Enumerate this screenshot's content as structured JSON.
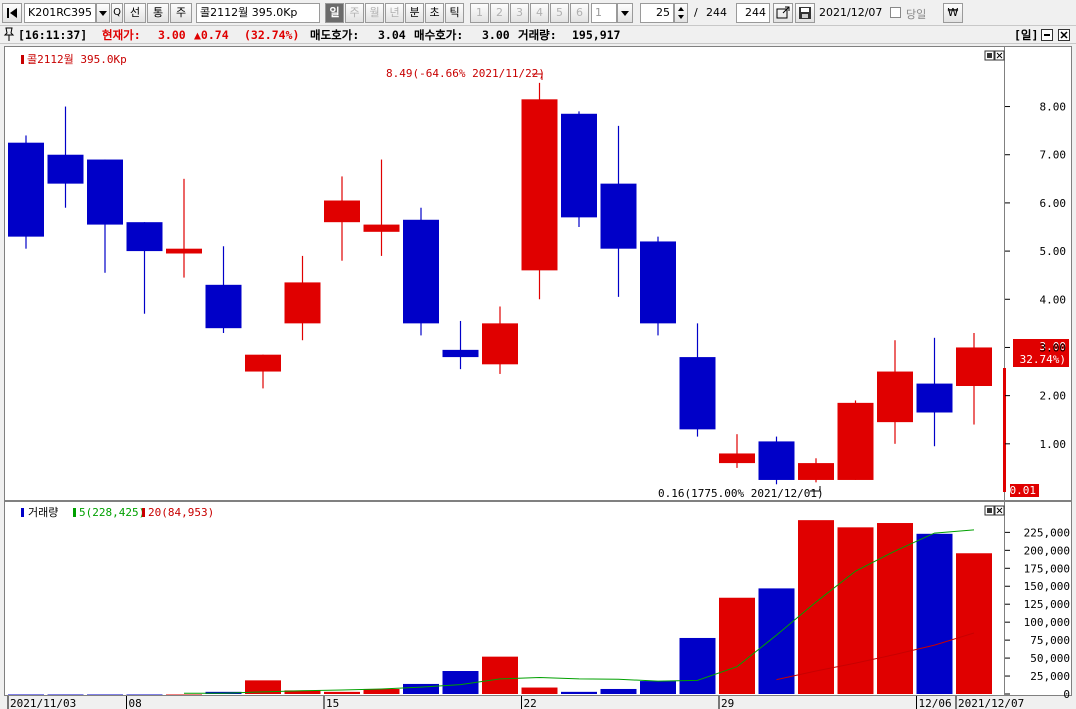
{
  "toolbar": {
    "prev_icon": "first-page-icon",
    "code": "K201RC395",
    "btn_search": "Q",
    "btn_prev_code": "선",
    "btn_compare": "통",
    "btn_main": "주",
    "name": "콜2112월 395.0Kp",
    "periods": [
      "일",
      "주",
      "월",
      "년",
      "분",
      "초",
      "틱"
    ],
    "period_active": "일",
    "numbers": [
      "1",
      "2",
      "3",
      "4",
      "5",
      "6"
    ],
    "number_select": "1",
    "count": "25",
    "slash": "/",
    "total": "244",
    "total_box": "244",
    "date": "2021/12/07",
    "same_day_label": "당일",
    "currency_icon": "₩"
  },
  "status": {
    "pin_icon": "pin-icon",
    "time": "[16:11:37]",
    "current_label": "현재가:",
    "current_value": "3.00",
    "change": "▲0.74",
    "change_pct": "(32.74%)",
    "ask_label": "매도호가:",
    "ask_value": "3.04",
    "bid_label": "매수호가:",
    "bid_value": "3.00",
    "volume_label": "거래량:",
    "volume_value": "195,917",
    "period_label": "[일]"
  },
  "price_panel": {
    "legend": "콜2112월 395.0Kp",
    "high_note": "8.49(-64.66% 2021/11/22)",
    "low_note": "0.16(1775.00% 2021/12/01)",
    "last_price_tag": "3.00",
    "last_pct_tag": "( 32.74%)",
    "zero_tag": "0.01"
  },
  "volume_panel": {
    "legend_title": "거래량",
    "legend_ma5": "5(228,425)",
    "legend_ma20": "20(84,953)"
  },
  "colors": {
    "up": "#e00000",
    "down": "#0000c8",
    "ma5": "#00a000",
    "ma20": "#c80000"
  },
  "chart_data": {
    "type": "candlestick",
    "price_ticks": [
      "8.00",
      "7.00",
      "6.00",
      "5.00",
      "4.00",
      "3.00",
      "2.00",
      "1.00"
    ],
    "price_tick_values": [
      8,
      7,
      6,
      5,
      4,
      3,
      2,
      1
    ],
    "price_range": [
      0,
      8.8
    ],
    "volume_ticks": [
      "225,000",
      "200,000",
      "175,000",
      "150,000",
      "125,000",
      "100,000",
      "75,000",
      "50,000",
      "25,000",
      "0"
    ],
    "volume_tick_values": [
      225000,
      200000,
      175000,
      150000,
      125000,
      100000,
      75000,
      50000,
      25000,
      0
    ],
    "volume_range": [
      0,
      245000
    ],
    "x_labels": [
      {
        "label": "2021/11/03",
        "index": 0
      },
      {
        "label": "08",
        "index": 3
      },
      {
        "label": "15",
        "index": 8
      },
      {
        "label": "22",
        "index": 13
      },
      {
        "label": "29",
        "index": 18
      },
      {
        "label": "12/06",
        "index": 23
      },
      {
        "label": "2021/12/07",
        "index": 24
      }
    ],
    "candles": [
      {
        "o": 7.25,
        "h": 7.4,
        "l": 5.05,
        "c": 5.3
      },
      {
        "o": 7.0,
        "h": 8.0,
        "l": 5.9,
        "c": 6.4
      },
      {
        "o": 6.9,
        "h": 6.9,
        "l": 4.55,
        "c": 5.55
      },
      {
        "o": 5.6,
        "h": 5.6,
        "l": 3.7,
        "c": 5.0
      },
      {
        "o": 4.95,
        "h": 6.5,
        "l": 4.45,
        "c": 5.05
      },
      {
        "o": 4.3,
        "h": 5.1,
        "l": 3.3,
        "c": 3.4
      },
      {
        "o": 2.5,
        "h": 2.85,
        "l": 2.15,
        "c": 2.85
      },
      {
        "o": 3.5,
        "h": 4.9,
        "l": 3.15,
        "c": 4.35
      },
      {
        "o": 5.6,
        "h": 6.55,
        "l": 4.8,
        "c": 6.05
      },
      {
        "o": 5.4,
        "h": 6.9,
        "l": 4.9,
        "c": 5.55
      },
      {
        "o": 5.65,
        "h": 5.9,
        "l": 3.25,
        "c": 3.5
      },
      {
        "o": 2.95,
        "h": 3.55,
        "l": 2.55,
        "c": 2.8
      },
      {
        "o": 2.65,
        "h": 3.85,
        "l": 2.45,
        "c": 3.5
      },
      {
        "o": 4.6,
        "h": 8.49,
        "l": 4.0,
        "c": 8.15
      },
      {
        "o": 7.85,
        "h": 7.9,
        "l": 5.5,
        "c": 5.7
      },
      {
        "o": 6.4,
        "h": 7.6,
        "l": 4.05,
        "c": 5.05
      },
      {
        "o": 5.2,
        "h": 5.3,
        "l": 3.25,
        "c": 3.5
      },
      {
        "o": 2.8,
        "h": 3.5,
        "l": 1.15,
        "c": 1.3
      },
      {
        "o": 0.6,
        "h": 1.2,
        "l": 0.5,
        "c": 0.8
      },
      {
        "o": 1.05,
        "h": 1.15,
        "l": 0.16,
        "c": 0.25
      },
      {
        "o": 0.25,
        "h": 0.7,
        "l": 0.2,
        "c": 0.6
      },
      {
        "o": 0.25,
        "h": 1.9,
        "l": 0.25,
        "c": 1.85
      },
      {
        "o": 1.45,
        "h": 3.15,
        "l": 1.0,
        "c": 2.5
      },
      {
        "o": 2.25,
        "h": 3.2,
        "l": 0.95,
        "c": 1.65
      },
      {
        "o": 2.2,
        "h": 3.3,
        "l": 1.4,
        "c": 3.0
      }
    ],
    "volumes": [
      0,
      0,
      0,
      0,
      0,
      3000,
      19000,
      5000,
      3000,
      7000,
      14000,
      32000,
      52000,
      9000,
      3000,
      7000,
      18000,
      78000,
      134000,
      147000,
      242000,
      232000,
      238000,
      223000,
      195917
    ],
    "ma5": [
      null,
      null,
      null,
      null,
      1000,
      1000,
      3000,
      4500,
      5500,
      7000,
      9500,
      13000,
      21000,
      23000,
      21000,
      20500,
      18000,
      19000,
      38000,
      82000,
      128000,
      171000,
      199000,
      224000,
      228425
    ],
    "ma20": [
      null,
      null,
      null,
      null,
      null,
      null,
      null,
      null,
      null,
      null,
      null,
      null,
      null,
      null,
      null,
      null,
      null,
      null,
      null,
      20000,
      32000,
      43000,
      55000,
      68000,
      84953
    ]
  }
}
